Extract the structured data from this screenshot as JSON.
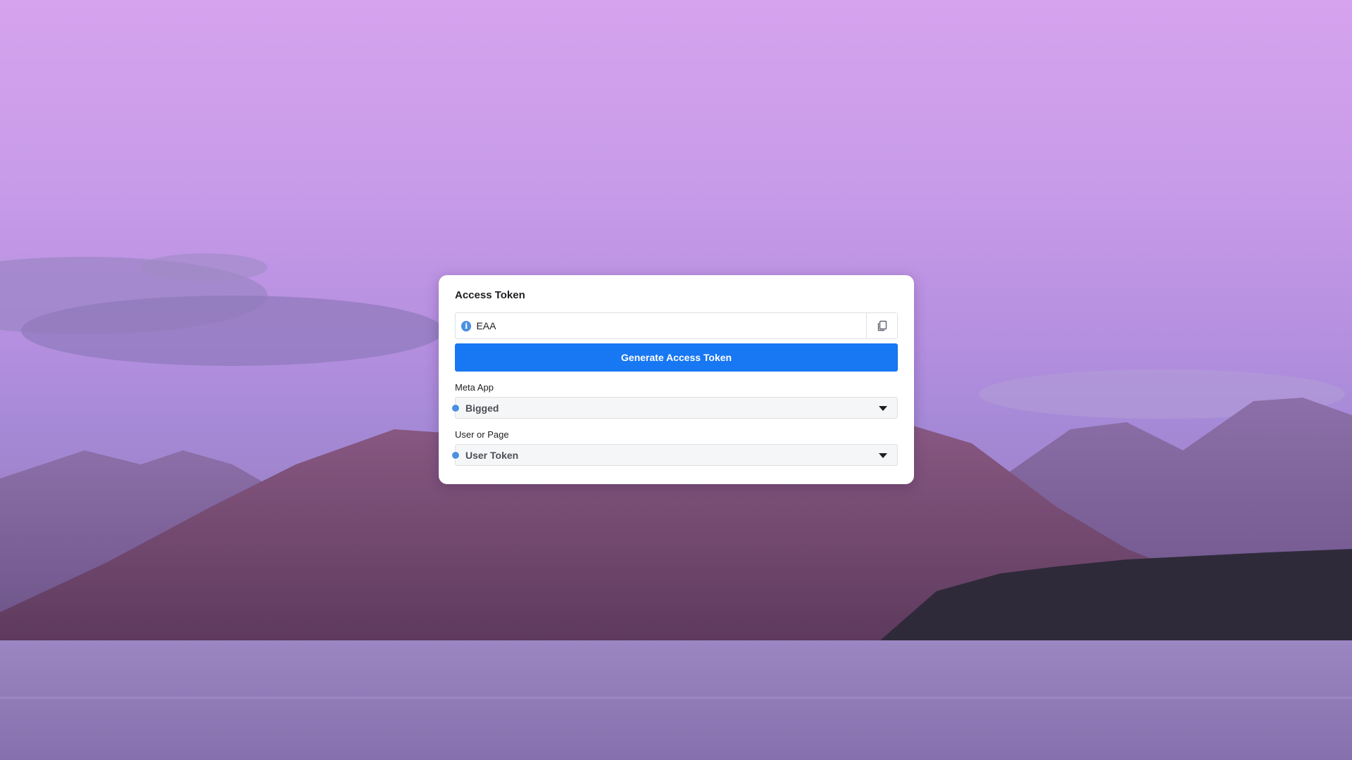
{
  "card": {
    "title": "Access Token",
    "token": {
      "value": "EAA",
      "info_icon": "info-icon",
      "copy_icon": "copy-icon"
    },
    "generate_label": "Generate Access Token",
    "meta_app": {
      "label": "Meta App",
      "selected": "Bigged"
    },
    "user_or_page": {
      "label": "User or Page",
      "selected": "User Token"
    }
  },
  "colors": {
    "primary_button": "#1877f2",
    "status_dot": "#4a90e2",
    "card_background": "#ffffff"
  }
}
